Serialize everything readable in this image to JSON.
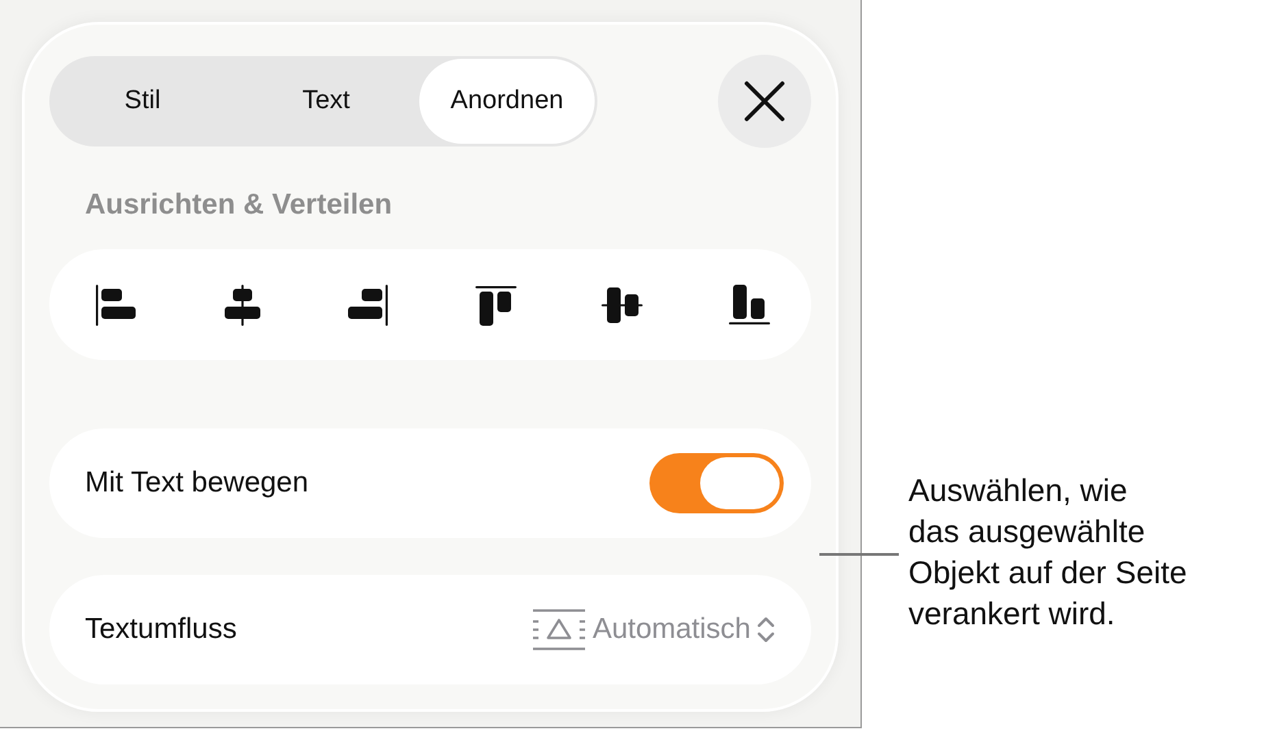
{
  "tabs": [
    {
      "label": "Stil",
      "selected": false
    },
    {
      "label": "Text",
      "selected": false
    },
    {
      "label": "Anordnen",
      "selected": true
    }
  ],
  "section_title": "Ausrichten & Verteilen",
  "align_buttons": [
    {
      "kind": "left"
    },
    {
      "kind": "center"
    },
    {
      "kind": "right"
    },
    {
      "kind": "top"
    },
    {
      "kind": "middle"
    },
    {
      "kind": "bottom"
    }
  ],
  "move_with_text": {
    "label": "Mit Text bewegen",
    "on": true
  },
  "text_wrap": {
    "label": "Textumfluss",
    "value": "Automatisch"
  },
  "callout": "Auswählen, wie\ndas ausgewählte\nObjekt auf der Seite\nverankert wird."
}
